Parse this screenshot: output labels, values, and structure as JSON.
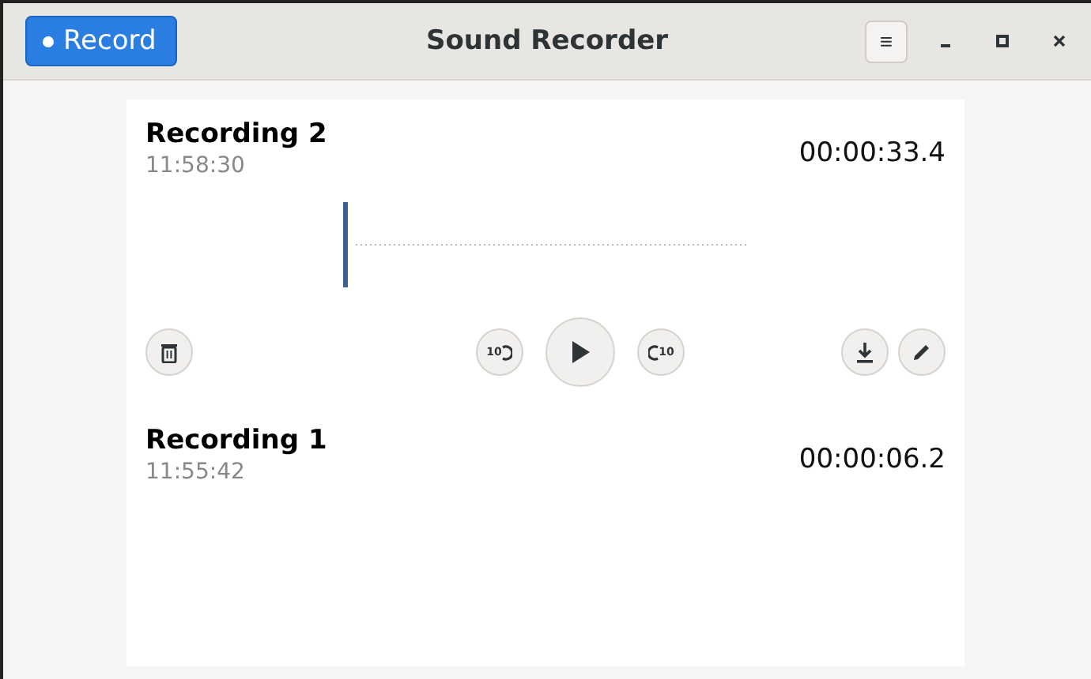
{
  "window": {
    "title": "Sound Recorder"
  },
  "record_button": {
    "label": "Record"
  },
  "menu_button": {
    "label": "≡"
  },
  "player": {
    "skip_back": "10",
    "skip_forward": "10"
  },
  "recordings": [
    {
      "name": "Recording 2",
      "time": "11:58:30",
      "duration": "00:00:33.4",
      "expanded": true
    },
    {
      "name": "Recording 1",
      "time": "11:55:42",
      "duration": "00:00:06.2",
      "expanded": false
    }
  ]
}
